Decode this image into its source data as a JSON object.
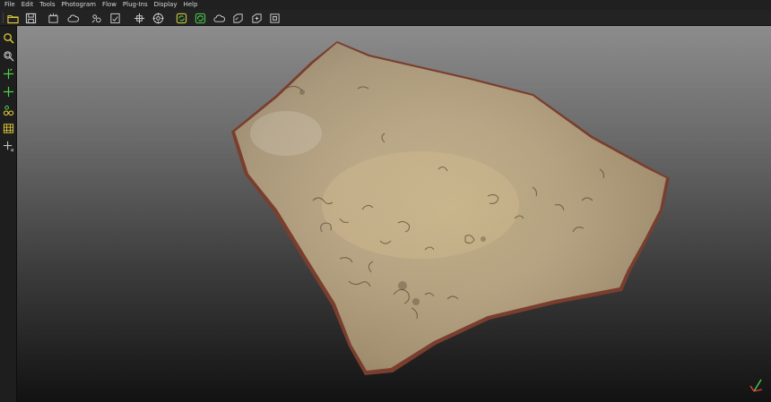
{
  "menu": {
    "items": [
      "File",
      "Edit",
      "Tools",
      "Photogram",
      "Flow",
      "Plug-Ins",
      "Display",
      "Help"
    ]
  },
  "toolbar": {
    "buttons": [
      "open-folder-icon",
      "save-icon",
      "new-block-icon",
      "cloud-icon",
      "photo-align-icon",
      "checklist-icon",
      "transform-icon",
      "target-icon",
      "process-icon",
      "flow-refresh-icon",
      "cloud-upload-icon",
      "export-model-icon",
      "export-texture-icon",
      "export-mesh-icon"
    ]
  },
  "leftbar": {
    "tools": [
      "zoom-icon",
      "zoom-region-icon",
      "add-point-icon",
      "move-point-icon",
      "measure-icon",
      "grid-icon",
      "pan-icon"
    ]
  },
  "colors": {
    "accent_yellow": "#e8d23a",
    "accent_green": "#4bd04b",
    "stone_base": "#b8a37f",
    "stone_edge": "#7a3e2e"
  },
  "viewport": {
    "object": "3d-stone-slab-model",
    "axis_widget": "axis-gizmo"
  }
}
